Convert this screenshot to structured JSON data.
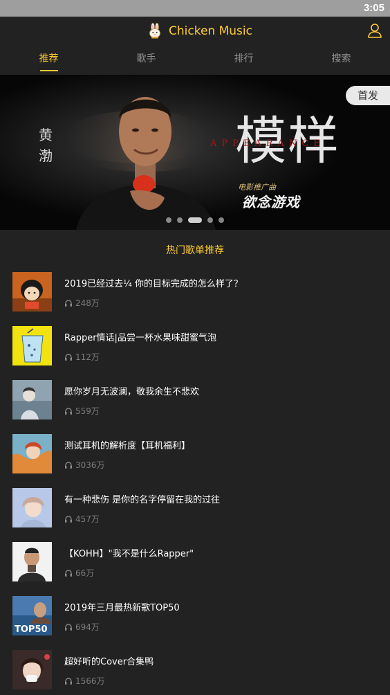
{
  "status_bar": {
    "time": "3:05"
  },
  "header": {
    "title": "Chicken Music",
    "logo_icon": "rabbit-logo-icon",
    "user_icon": "user-icon",
    "accent_color": "#ffcd32"
  },
  "tabs": [
    {
      "label": "推荐",
      "active": true
    },
    {
      "label": "歌手",
      "active": false
    },
    {
      "label": "排行",
      "active": false
    },
    {
      "label": "搜索",
      "active": false
    }
  ],
  "banner": {
    "badge": "首发",
    "vertical_name": "黄渤",
    "headline": "模样",
    "english": "APPEARANCE",
    "subtitle_small": "电影推广曲",
    "subtitle_big": "欲念游戏",
    "slide_count": 5,
    "active_slide": 3
  },
  "section_title": "热门歌单推荐",
  "playlists": [
    {
      "title": "2019已经过去¼ 你的目标完成的怎么样了？",
      "plays": "248万"
    },
    {
      "title": "Rapper情话|品尝一杯水果味甜蜜气泡",
      "plays": "112万"
    },
    {
      "title": "愿你岁月无波澜，敬我余生不悲欢",
      "plays": "559万"
    },
    {
      "title": "测试耳机的解析度【耳机福利】",
      "plays": "3036万"
    },
    {
      "title": "有一种悲伤 是你的名字停留在我的过往",
      "plays": "457万"
    },
    {
      "title": "【KOHH】\"我不是什么Rapper\"",
      "plays": "66万"
    },
    {
      "title": "2019年三月最热新歌TOP50",
      "plays": "694万"
    },
    {
      "title": "超好听的Cover合集鸭",
      "plays": "1566万"
    }
  ],
  "thumb_overlay_text": {
    "item6": "TOP50"
  },
  "play_count_icon": "headphones-icon"
}
